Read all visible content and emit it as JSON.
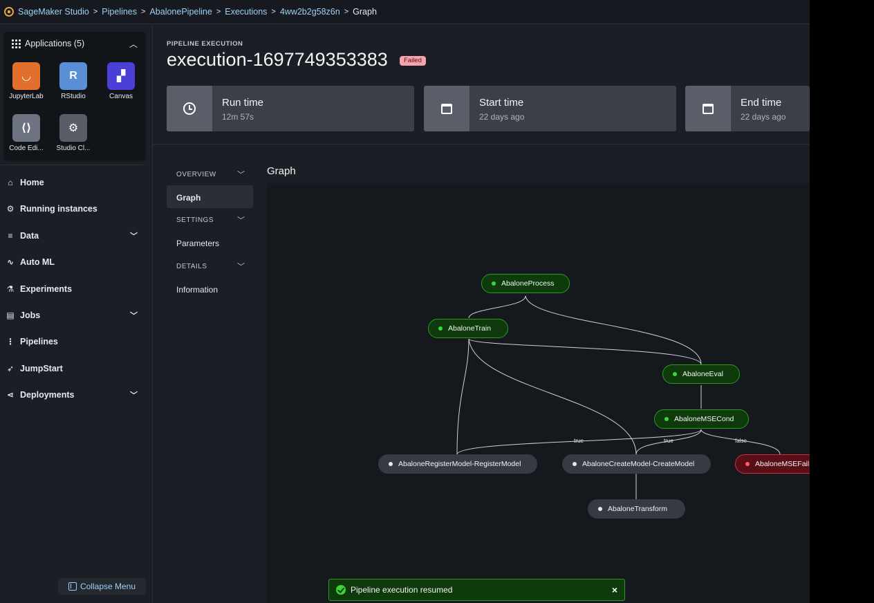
{
  "breadcrumb": {
    "items": [
      "SageMaker Studio",
      "Pipelines",
      "AbalonePipeline",
      "Executions",
      "4ww2b2g58z6n"
    ],
    "current": "Graph",
    "separator": ">"
  },
  "sidebar": {
    "applications": {
      "title": "Applications (5)",
      "apps": [
        {
          "label": "JupyterLab",
          "icon": "jupyterlab-icon",
          "color": "#e36f2c",
          "glyph": "◡"
        },
        {
          "label": "RStudio",
          "icon": "rstudio-icon",
          "color": "#5a8fd6",
          "glyph": "R"
        },
        {
          "label": "Canvas",
          "icon": "canvas-icon",
          "color": "#4a3fd6",
          "glyph": "▞"
        },
        {
          "label": "Code Edi...",
          "icon": "code-editor-icon",
          "color": "#6d7380",
          "glyph": "⟨⟩"
        },
        {
          "label": "Studio Cl...",
          "icon": "studio-classic-icon",
          "color": "#585d68",
          "glyph": "⚙"
        }
      ]
    },
    "nav": [
      {
        "label": "Home",
        "icon": "⌂",
        "chevron": false
      },
      {
        "label": "Running instances",
        "icon": "⚙",
        "chevron": false
      },
      {
        "label": "Data",
        "icon": "≡",
        "chevron": true
      },
      {
        "label": "Auto ML",
        "icon": "∿",
        "chevron": false
      },
      {
        "label": "Experiments",
        "icon": "⚗",
        "chevron": false
      },
      {
        "label": "Jobs",
        "icon": "▤",
        "chevron": true
      },
      {
        "label": "Pipelines",
        "icon": "⋮",
        "chevron": false
      },
      {
        "label": "JumpStart",
        "icon": "➶",
        "chevron": false
      },
      {
        "label": "Deployments",
        "icon": "⋖",
        "chevron": true
      }
    ],
    "collapse_label": "Collapse Menu"
  },
  "header": {
    "label": "PIPELINE EXECUTION",
    "title": "execution-1697749353383",
    "status": "Failed"
  },
  "stats": [
    {
      "title": "Run time",
      "value": "12m 57s",
      "icon": "clock-icon"
    },
    {
      "title": "Start time",
      "value": "22 days ago",
      "icon": "calendar-icon"
    },
    {
      "title": "End time",
      "value": "22 days ago",
      "icon": "calendar-icon"
    }
  ],
  "subnav": {
    "overview": "OVERVIEW",
    "graph": "Graph",
    "settings": "SETTINGS",
    "parameters": "Parameters",
    "details": "DETAILS",
    "information": "Information"
  },
  "graph": {
    "title": "Graph",
    "nodes": [
      {
        "id": "process",
        "label": "AbaloneProcess",
        "status": "ok"
      },
      {
        "id": "train",
        "label": "AbaloneTrain",
        "status": "ok"
      },
      {
        "id": "eval",
        "label": "AbaloneEval",
        "status": "ok"
      },
      {
        "id": "cond",
        "label": "AbaloneMSECond",
        "status": "ok"
      },
      {
        "id": "register",
        "label": "AbaloneRegisterModel-RegisterModel",
        "status": "pending"
      },
      {
        "id": "create",
        "label": "AbaloneCreateModel-CreateModel",
        "status": "pending"
      },
      {
        "id": "fail",
        "label": "AbaloneMSEFail",
        "status": "fail"
      },
      {
        "id": "transform",
        "label": "AbaloneTransform",
        "status": "pending"
      }
    ],
    "edge_labels": {
      "to_register": "true",
      "to_create": "true",
      "to_fail": "false"
    }
  },
  "toast": {
    "message": "Pipeline execution resumed",
    "close": "×"
  }
}
